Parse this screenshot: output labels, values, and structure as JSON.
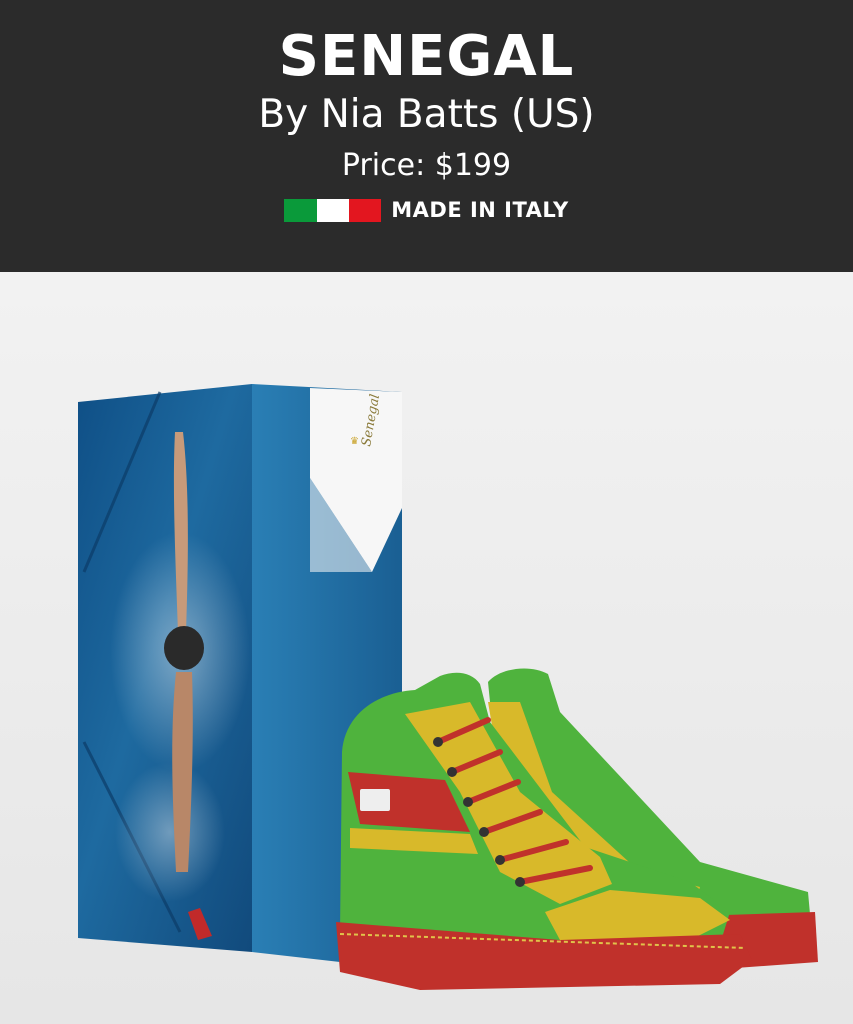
{
  "product": {
    "title": "SENEGAL",
    "designer": "By Nia Batts (US)",
    "price": "Price: $199",
    "origin": "MADE IN ITALY"
  },
  "flag": {
    "name": "italy-flag",
    "colors": [
      "#0a9a3a",
      "#ffffff",
      "#e3161f"
    ]
  },
  "box": {
    "label": "Senegal"
  },
  "colors": {
    "header_bg": "#2b2b2b",
    "shoe_green": "#4fb33d",
    "shoe_yellow": "#d8b92a",
    "shoe_red": "#c0312b",
    "water_blue": "#1e6aa0"
  }
}
